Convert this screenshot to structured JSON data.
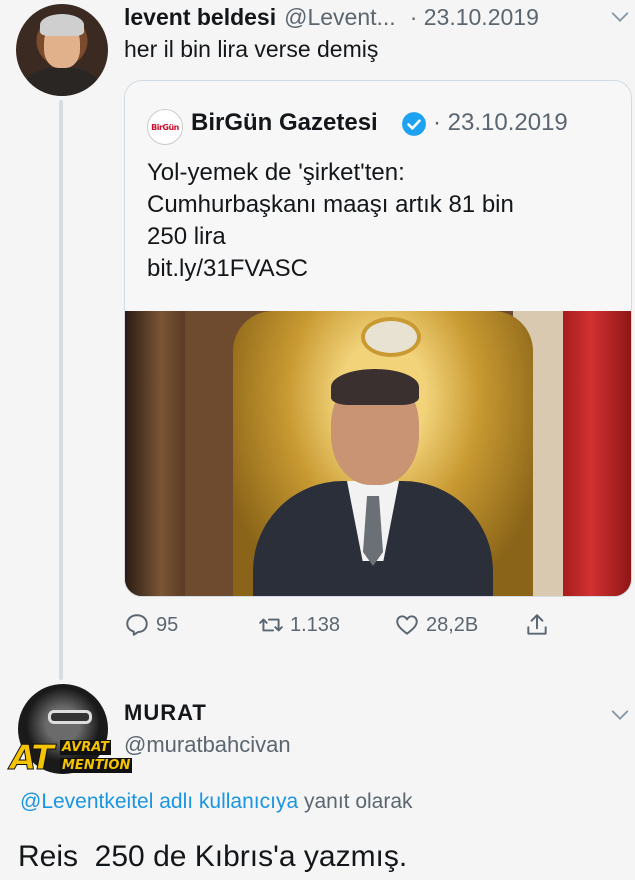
{
  "tweet1": {
    "name": "levent beldesi",
    "handle": "@Levent...",
    "date": "· 23.10.2019",
    "text": "her il bin lira verse demiş"
  },
  "quoted": {
    "logo_text": "BirGün",
    "name": "BirGün Gazetesi",
    "date": "· 23.10.2019",
    "lines": [
      "Yol-yemek de 'şirket'ten:",
      "Cumhurbaşkanı maaşı artık 81 bin",
      "250 lira",
      "bit.ly/31FVASC"
    ]
  },
  "actions": {
    "replies": "95",
    "retweets": "1.138",
    "likes": "28,2B"
  },
  "tweet2": {
    "name": "MURAT",
    "handle": "@muratbahcivan",
    "logo_at": "AT",
    "logo_line1": "AVRAT",
    "logo_line2": "MENTION",
    "reply_mention": "@Leventkeitel adlı kullanıcıya",
    "reply_suffix": " yanıt olarak",
    "text": "Reis  250 de Kıbrıs'a yazmış."
  },
  "colors": {
    "text": "#14171a",
    "muted": "#5b6670",
    "link": "#1b95e0",
    "verified": "#1da1f2"
  }
}
